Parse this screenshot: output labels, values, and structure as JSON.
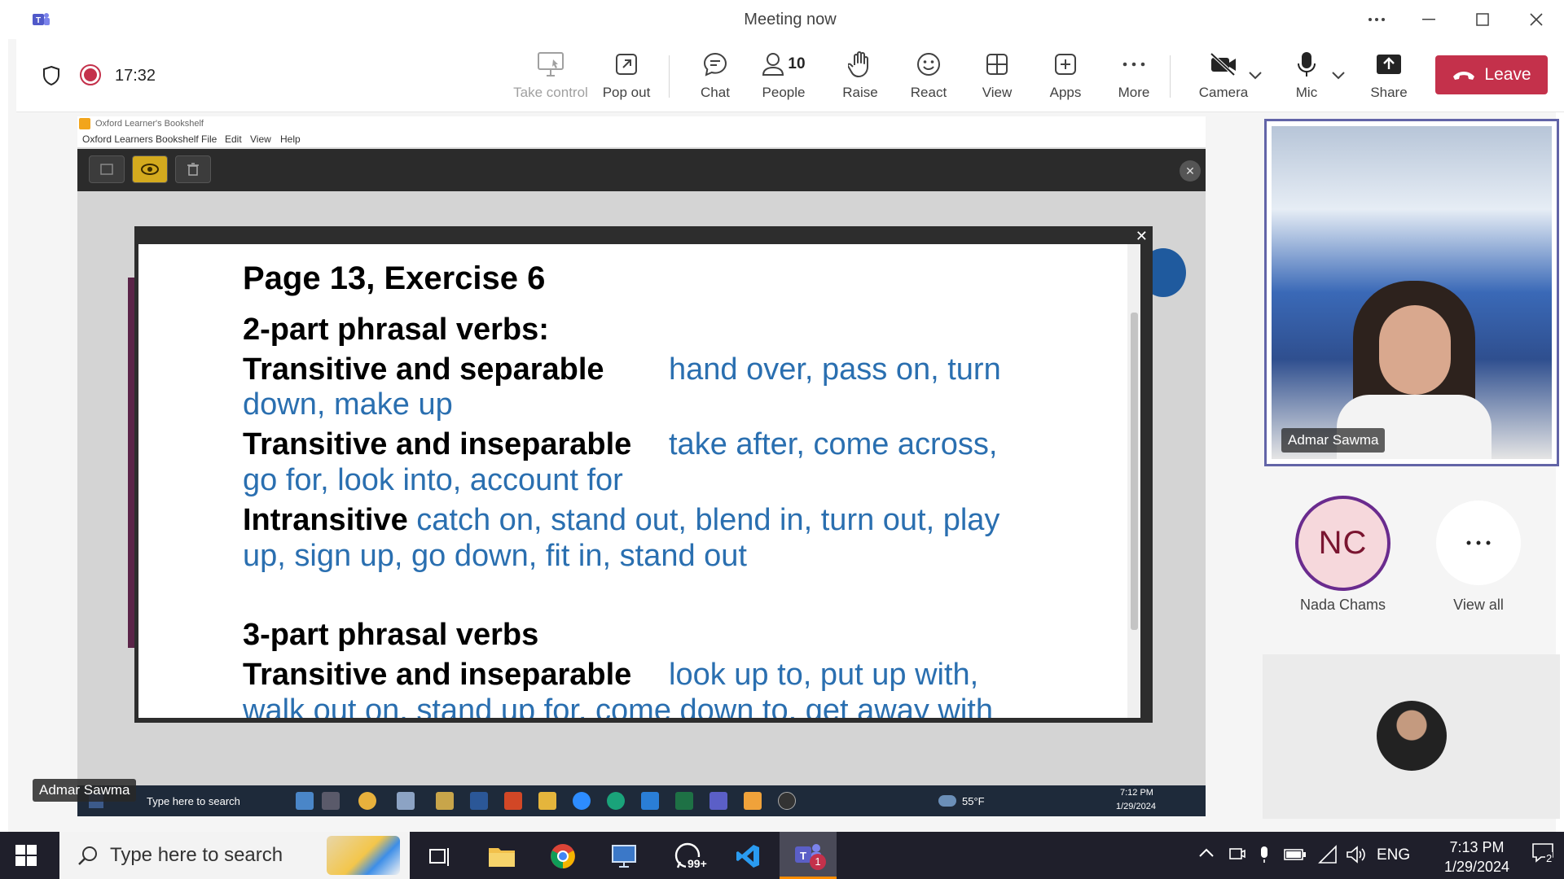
{
  "window": {
    "title": "Meeting now"
  },
  "toolbar": {
    "timer": "17:32",
    "buttons": {
      "take_control": "Take control",
      "pop_out": "Pop out",
      "chat": "Chat",
      "people": "People",
      "people_count": "10",
      "raise": "Raise",
      "react": "React",
      "view": "View",
      "apps": "Apps",
      "more": "More",
      "camera": "Camera",
      "mic": "Mic",
      "share": "Share",
      "leave": "Leave"
    }
  },
  "shared_screen": {
    "app_title": "Oxford Learner's Bookshelf",
    "menu": [
      "Oxford Learners Bookshelf",
      "File",
      "Edit",
      "View",
      "Help"
    ],
    "exercise": {
      "heading": "Page 13, Exercise 6",
      "two_part_heading": "2-part phrasal verbs:",
      "sep_label": "Transitive and separable",
      "sep_verbs_1": "hand over, pass on, turn",
      "sep_verbs_2": "down, make up",
      "insep_label": "Transitive and inseparable",
      "insep_verbs_1": "take after, come across,",
      "insep_verbs_2": "go for, look into, account for",
      "intrans_label": "Intransitive",
      "intrans_verbs_1": "catch on, stand out, blend in, turn out, play",
      "intrans_verbs_2": "up, sign up, go down, fit in, stand out",
      "three_part_heading": "3-part phrasal verbs",
      "three_insep_label": "Transitive and inseparable",
      "three_insep_verbs_1": "look up to, put up with,",
      "three_insep_verbs_2": "walk out on, stand up for, come down to, get away with"
    },
    "taskbar": {
      "search": "Type here to search",
      "weather": "55°F",
      "time": "7:12 PM",
      "date": "1/29/2024"
    },
    "presenter_tag": "Admar Sawma"
  },
  "participants": {
    "video_name": "Admar Sawma",
    "nc_initials": "NC",
    "nc_name": "Nada Chams",
    "view_all": "View all"
  },
  "os_taskbar": {
    "search": "Type here to search",
    "whatsapp_badge": "99+",
    "teams_badge": "1",
    "language": "ENG",
    "time": "7:13 PM",
    "date": "1/29/2024",
    "notifications": "2"
  },
  "colors": {
    "leave": "#c4314b",
    "accent": "#6264a7",
    "exercise_blue": "#2a6fb0"
  }
}
